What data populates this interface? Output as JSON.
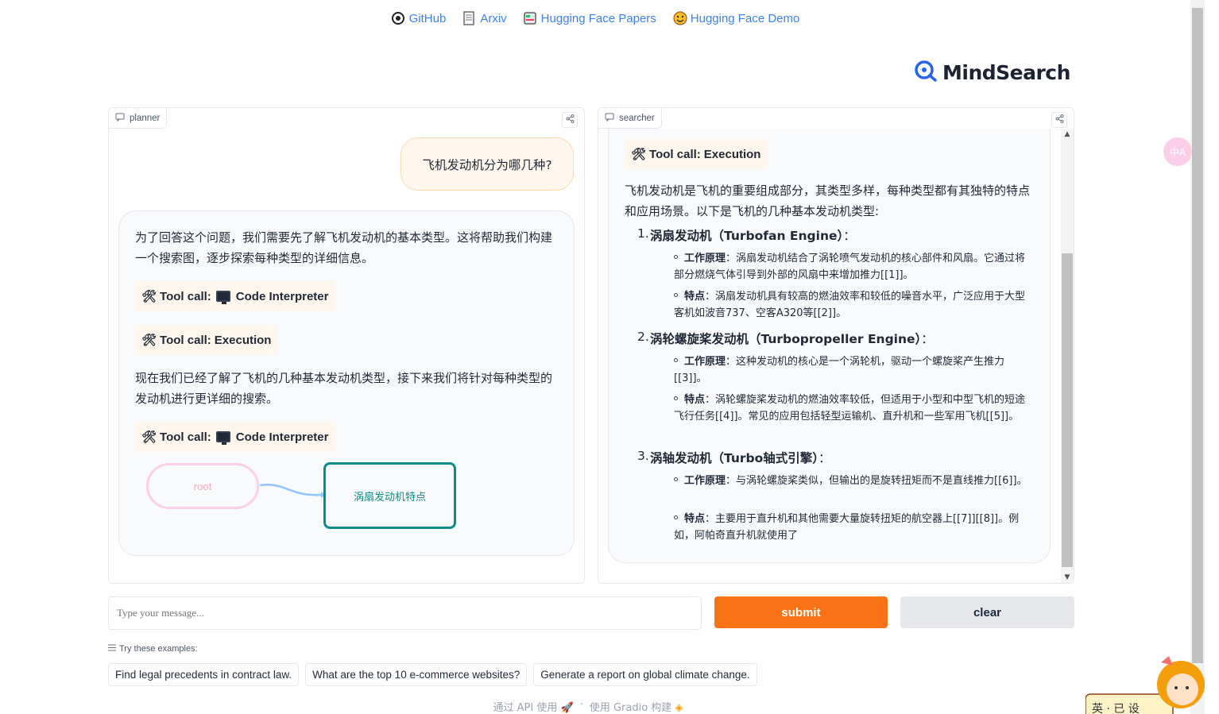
{
  "top_links": [
    {
      "label": "GitHub",
      "icon": "github-icon"
    },
    {
      "label": "Arxiv",
      "icon": "document-icon"
    },
    {
      "label": "Hugging Face Papers",
      "icon": "papers-icon"
    },
    {
      "label": "Hugging Face Demo",
      "icon": "hugging-face-icon"
    }
  ],
  "logo": {
    "text": "MindSearch"
  },
  "planner": {
    "label": "planner",
    "user_message": "飞机发动机分为哪几种?",
    "para1": "为了回答这个问题，我们需要先了解飞机发动机的基本类型。这将帮助我们构建一个搜索图，逐步探索每种类型的详细信息。",
    "tool1": {
      "prefix": "Tool call:",
      "name": "Code Interpreter"
    },
    "tool2": {
      "prefix": "Tool call:",
      "name": "Execution"
    },
    "para2": "现在我们已经了解了飞机的几种基本发动机类型，接下来我们将针对每种类型的发动机进行更详细的搜索。",
    "tool3": {
      "prefix": "Tool call:",
      "name": "Code Interpreter"
    },
    "graph": {
      "root": "root",
      "child": "涡扇发动机特点"
    }
  },
  "searcher": {
    "label": "searcher",
    "tool": {
      "prefix": "Tool call:",
      "name": "Execution"
    },
    "intro": "飞机发动机是飞机的重要组成部分，其类型多样，每种类型都有其独特的特点和应用场景。以下是飞机的几种基本发动机类型:",
    "items": [
      {
        "num": "1.",
        "title": "涡扇发动机（Turbofan Engine）",
        "suffix": "：",
        "points": [
          {
            "k": "工作原理",
            "v": "：涡扇发动机结合了涡轮喷气发动机的核心部件和风扇。它通过将部分燃烧气体引导到外部的风扇中来增加推力[[1]]。"
          },
          {
            "k": "特点",
            "v": "：涡扇发动机具有较高的燃油效率和较低的噪音水平，广泛应用于大型客机如波音737、空客A320等[[2]]。"
          }
        ]
      },
      {
        "num": "2.",
        "title": "涡轮螺旋桨发动机（Turbopropeller Engine）",
        "suffix": "：",
        "points": [
          {
            "k": "工作原理",
            "v": "：这种发动机的核心是一个涡轮机，驱动一个螺旋桨产生推力[[3]]。"
          },
          {
            "k": "特点",
            "v": "：涡轮螺旋桨发动机的燃油效率较低，但适用于小型和中型飞机的短途飞行任务[[4]]。常见的应用包括轻型运输机、直升机和一些军用飞机[[5]]。"
          }
        ]
      },
      {
        "num": "3.",
        "title": "涡轴发动机（Turbo轴式引擎）",
        "suffix": "：",
        "points": [
          {
            "k": "工作原理",
            "v": "：与涡轮螺旋桨类似，但输出的是旋转扭矩而不是直线推力[[6]]。"
          },
          {
            "k": "特点",
            "v": "：主要用于直升机和其他需要大量旋转扭矩的航空器上[[7]][[8]]。例如，阿帕奇直升机就使用了"
          }
        ]
      }
    ]
  },
  "input": {
    "placeholder": "Type your message..."
  },
  "buttons": {
    "submit": "submit",
    "clear": "clear"
  },
  "examples": {
    "label": "Try these examples:",
    "items": [
      "Find legal precedents in contract law.",
      "What are the top 10 e-commerce websites?",
      "Generate a report on global climate change."
    ]
  },
  "footer": {
    "api": "通过 API 使用",
    "sep": "·",
    "built": "使用 Gradio 构建"
  },
  "mascot_text": "英 · 已 设",
  "translate_glyph": "中A",
  "colors": {
    "accent": "#f97316",
    "link": "#3b82f6",
    "node": "#0f8a8a"
  }
}
